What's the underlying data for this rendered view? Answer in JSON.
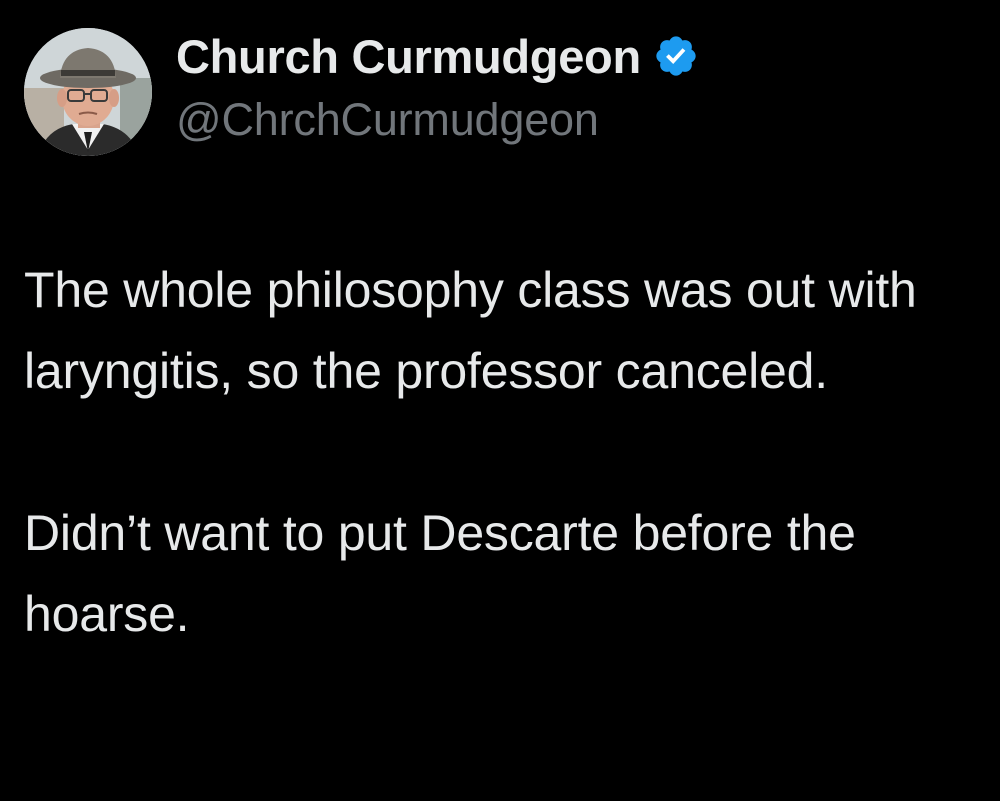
{
  "tweet": {
    "author": {
      "display_name": "Church Curmudgeon",
      "handle": "@ChrchCurmudgeon",
      "avatar_icon": "profile-photo-elderly-man-in-hat",
      "verified_icon": "verified-badge-icon"
    },
    "text": {
      "paragraph_1": "The whole philosophy class was out with laryngitis, so the professor canceled.",
      "paragraph_2": "Didn’t want to put Descarte before the hoarse."
    }
  },
  "colors": {
    "background": "#000000",
    "primary_text": "#e7e9ea",
    "secondary_text": "#71767b",
    "verified_blue": "#1d9bf0"
  }
}
